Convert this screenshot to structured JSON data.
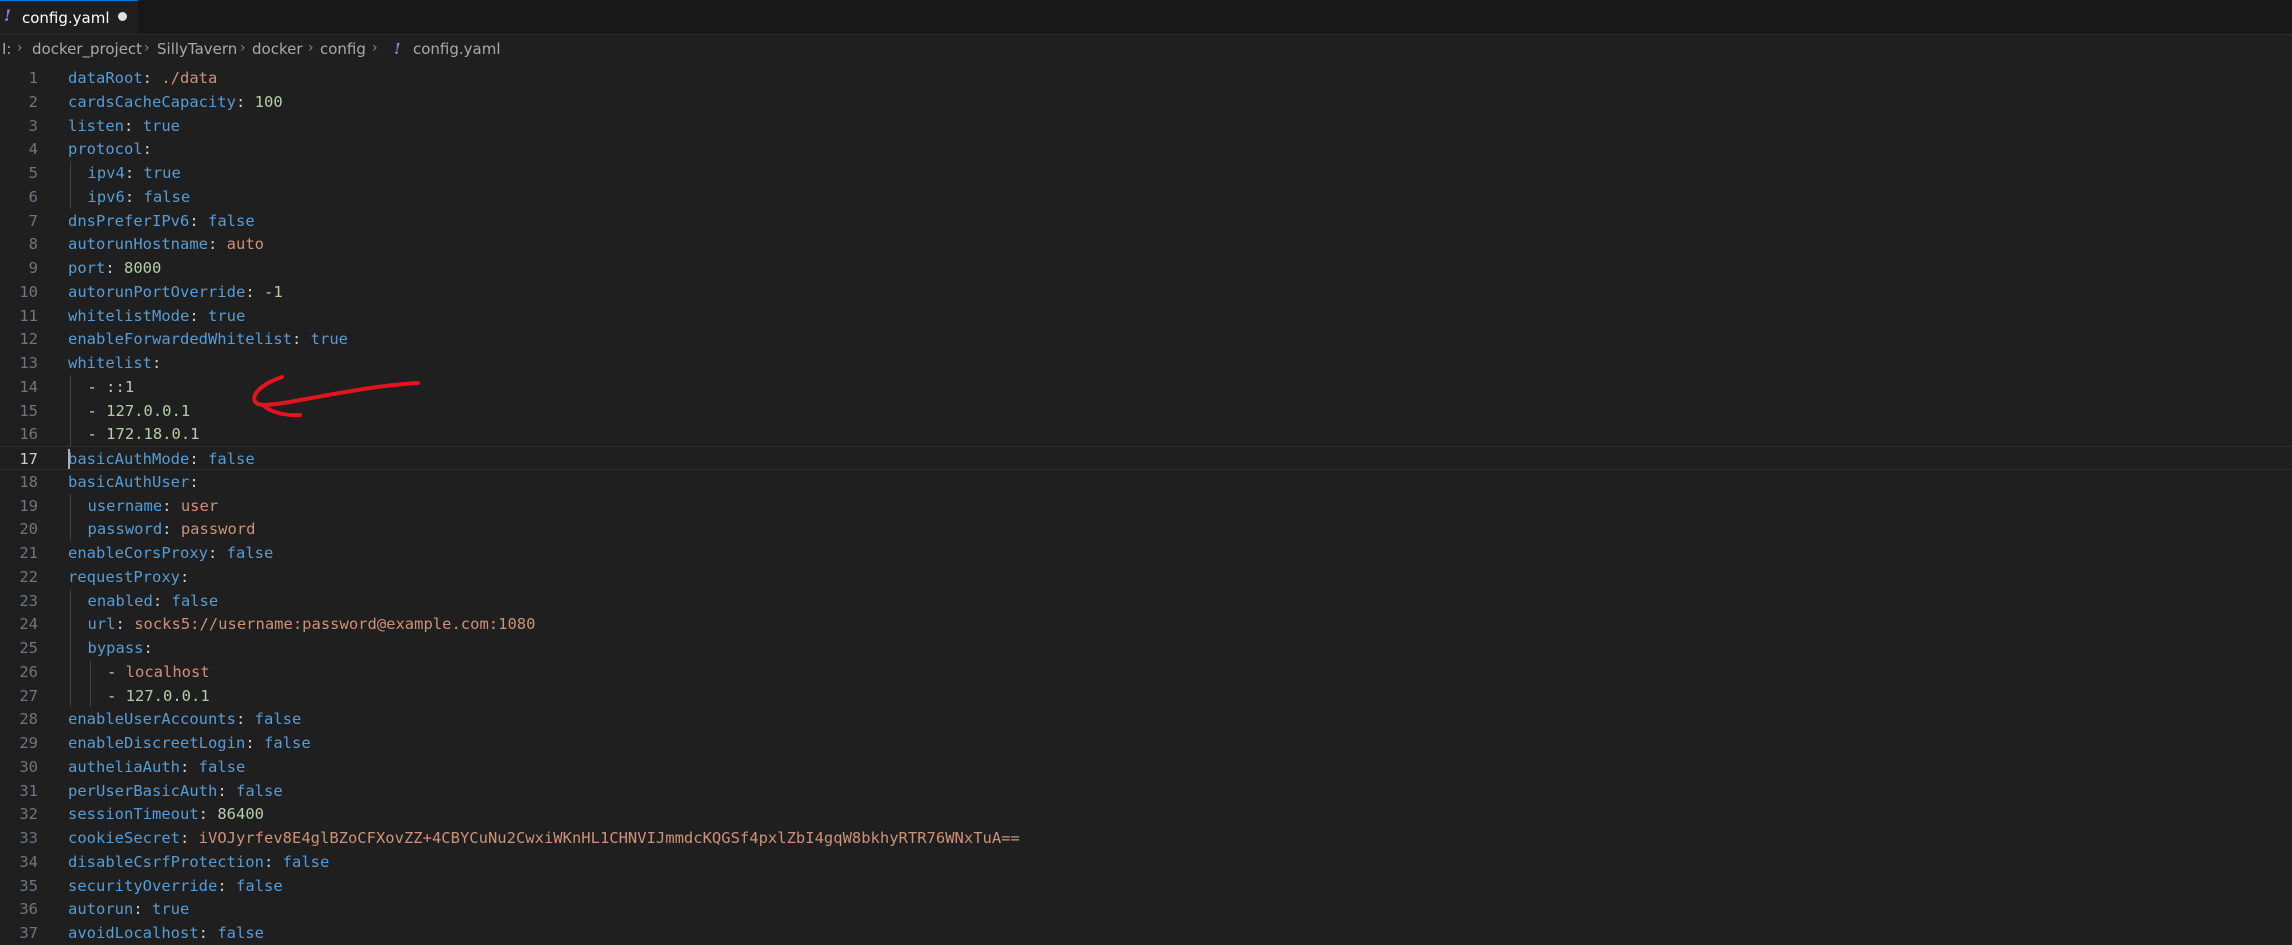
{
  "tab": {
    "icon": "!",
    "label": "config.yaml"
  },
  "breadcrumb": {
    "items": [
      "I:",
      "docker_project",
      "SillyTavern",
      "docker",
      "config"
    ],
    "file_icon": "!",
    "file": "config.yaml"
  },
  "active_line": 17,
  "lines": [
    {
      "n": "1",
      "indent": 0,
      "key": "dataRoot",
      "value": "./data",
      "type": "s"
    },
    {
      "n": "2",
      "indent": 0,
      "key": "cardsCacheCapacity",
      "value": "100",
      "type": "n"
    },
    {
      "n": "3",
      "indent": 0,
      "key": "listen",
      "value": "true",
      "type": "b"
    },
    {
      "n": "4",
      "indent": 0,
      "key": "protocol",
      "value": "",
      "type": ""
    },
    {
      "n": "5",
      "indent": 1,
      "key": "ipv4",
      "value": "true",
      "type": "b"
    },
    {
      "n": "6",
      "indent": 1,
      "key": "ipv6",
      "value": "false",
      "type": "b"
    },
    {
      "n": "7",
      "indent": 0,
      "key": "dnsPreferIPv6",
      "value": "false",
      "type": "b"
    },
    {
      "n": "8",
      "indent": 0,
      "key": "autorunHostname",
      "value": "auto",
      "type": "s"
    },
    {
      "n": "9",
      "indent": 0,
      "key": "port",
      "value": "8000",
      "type": "n"
    },
    {
      "n": "10",
      "indent": 0,
      "key": "autorunPortOverride",
      "value": "-1",
      "type": "n"
    },
    {
      "n": "11",
      "indent": 0,
      "key": "whitelistMode",
      "value": "true",
      "type": "b"
    },
    {
      "n": "12",
      "indent": 0,
      "key": "enableForwardedWhitelist",
      "value": "true",
      "type": "b"
    },
    {
      "n": "13",
      "indent": 0,
      "key": "whitelist",
      "value": "",
      "type": ""
    },
    {
      "n": "14",
      "indent": 1,
      "item": "::1",
      "type": "n"
    },
    {
      "n": "15",
      "indent": 1,
      "item": "127.0.0.1",
      "type": "n"
    },
    {
      "n": "16",
      "indent": 1,
      "item": "172.18.0.1",
      "type": "n"
    },
    {
      "n": "17",
      "indent": 0,
      "key": "basicAuthMode",
      "value": "false",
      "type": "b"
    },
    {
      "n": "18",
      "indent": 0,
      "key": "basicAuthUser",
      "value": "",
      "type": ""
    },
    {
      "n": "19",
      "indent": 1,
      "key": "username",
      "value": "user",
      "type": "s"
    },
    {
      "n": "20",
      "indent": 1,
      "key": "password",
      "value": "password",
      "type": "s"
    },
    {
      "n": "21",
      "indent": 0,
      "key": "enableCorsProxy",
      "value": "false",
      "type": "b"
    },
    {
      "n": "22",
      "indent": 0,
      "key": "requestProxy",
      "value": "",
      "type": ""
    },
    {
      "n": "23",
      "indent": 1,
      "key": "enabled",
      "value": "false",
      "type": "b"
    },
    {
      "n": "24",
      "indent": 1,
      "key": "url",
      "value": "socks5://username:password@example.com:1080",
      "type": "s"
    },
    {
      "n": "25",
      "indent": 1,
      "key": "bypass",
      "value": "",
      "type": ""
    },
    {
      "n": "26",
      "indent": 2,
      "item": "localhost",
      "type": "s"
    },
    {
      "n": "27",
      "indent": 2,
      "item": "127.0.0.1",
      "type": "n"
    },
    {
      "n": "28",
      "indent": 0,
      "key": "enableUserAccounts",
      "value": "false",
      "type": "b"
    },
    {
      "n": "29",
      "indent": 0,
      "key": "enableDiscreetLogin",
      "value": "false",
      "type": "b"
    },
    {
      "n": "30",
      "indent": 0,
      "key": "autheliaAuth",
      "value": "false",
      "type": "b"
    },
    {
      "n": "31",
      "indent": 0,
      "key": "perUserBasicAuth",
      "value": "false",
      "type": "b"
    },
    {
      "n": "32",
      "indent": 0,
      "key": "sessionTimeout",
      "value": "86400",
      "type": "n"
    },
    {
      "n": "33",
      "indent": 0,
      "key": "cookieSecret",
      "value": "iVOJyrfev8E4glBZoCFXovZZ+4CBYCuNu2CwxiWKnHL1CHNVIJmmdcKQGSf4pxlZbI4gqW8bkhyRTR76WNxTuA==",
      "type": "s"
    },
    {
      "n": "34",
      "indent": 0,
      "key": "disableCsrfProtection",
      "value": "false",
      "type": "b"
    },
    {
      "n": "35",
      "indent": 0,
      "key": "securityOverride",
      "value": "false",
      "type": "b"
    },
    {
      "n": "36",
      "indent": 0,
      "key": "autorun",
      "value": "true",
      "type": "b"
    },
    {
      "n": "37",
      "indent": 0,
      "key": "avoidLocalhost",
      "value": "false",
      "type": "b"
    }
  ],
  "colors": {
    "key": "#569cd6",
    "string": "#ce9178",
    "number": "#b5cea8",
    "annotation": "#e3141d"
  },
  "annotation": {
    "icon": "hand-drawn-arrow-icon",
    "points_to_line": 15
  }
}
